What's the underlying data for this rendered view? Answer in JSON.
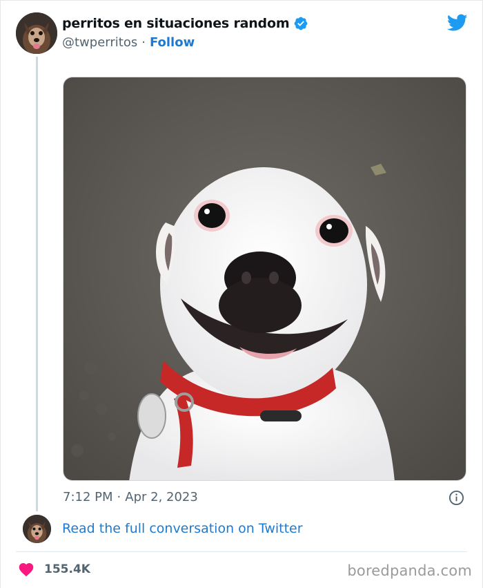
{
  "tweet": {
    "display_name": "perritos en situaciones random",
    "handle": "@twperritos",
    "separator": "·",
    "follow_label": "Follow",
    "verified": true,
    "timestamp_time": "7:12 PM",
    "timestamp_date": "Apr 2, 2023",
    "read_more_label": "Read the full conversation on Twitter",
    "like_count": "155.4K"
  },
  "footer": {
    "watermark": "boredpanda.com"
  },
  "icons": {
    "verified": "verified-badge-icon",
    "brand": "twitter-bird-icon",
    "info": "info-icon",
    "like": "heart-icon"
  },
  "colors": {
    "link": "#1d7ad0",
    "verified": "#1d9bf0",
    "twitter_brand": "#1d9bf0",
    "heart": "#f91880",
    "secondary_text": "#536471"
  }
}
